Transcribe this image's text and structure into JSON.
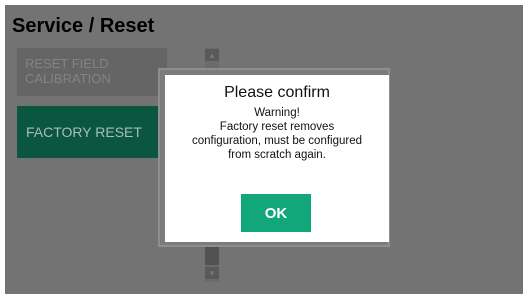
{
  "header": {
    "title": "Service / Reset"
  },
  "menu": {
    "items": [
      {
        "label_line1": "RESET FIELD",
        "label_line2": "CALIBRATION",
        "state": "disabled"
      },
      {
        "label": "FACTORY RESET",
        "state": "enabled"
      }
    ]
  },
  "scrollbar": {
    "up_icon": "triangle-up-icon",
    "down_icon": "triangle-down-icon"
  },
  "dialog": {
    "title": "Please confirm",
    "message_lines": [
      "Warning!",
      "Factory reset removes",
      "configuration, must be configured",
      "from scratch again."
    ],
    "ok_label": "OK"
  },
  "colors": {
    "background": "#737373",
    "accent": "#12a67b",
    "factory_button": "#0b5640"
  }
}
